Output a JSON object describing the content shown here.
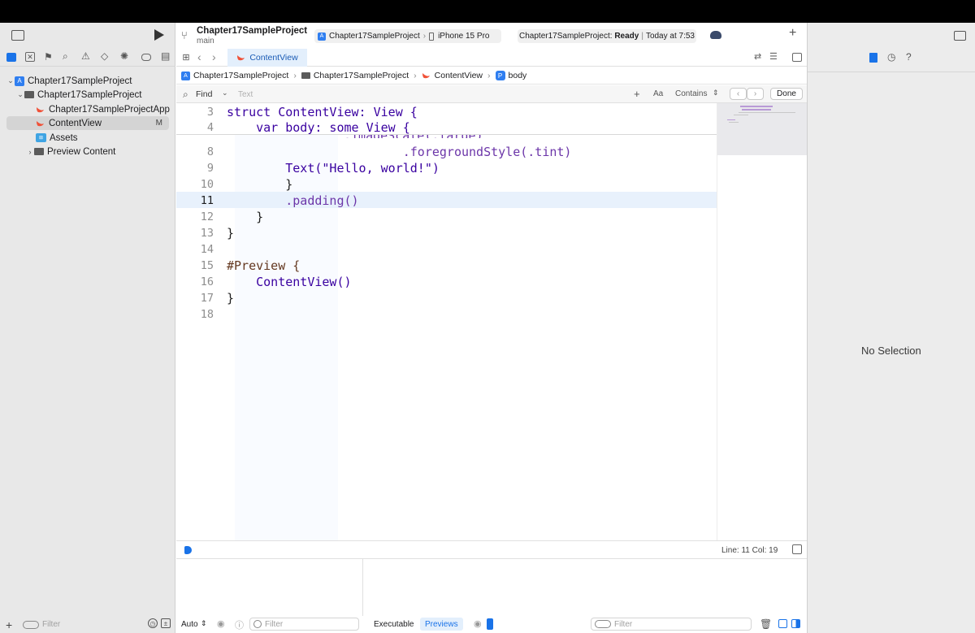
{
  "toolbar": {
    "project_name": "Chapter17SampleProject",
    "branch": "main",
    "scheme_target": "Chapter17SampleProject",
    "device": "iPhone 15 Pro",
    "status_project": "Chapter17SampleProject:",
    "status_state": "Ready",
    "status_time": "Today at 7:53"
  },
  "tab": {
    "label": "ContentView"
  },
  "jumpbar": {
    "items": [
      "Chapter17SampleProject",
      "Chapter17SampleProject",
      "ContentView"
    ],
    "symbol_badge": "P",
    "symbol": "body"
  },
  "find": {
    "mode": "Find",
    "placeholder": "Text",
    "case_label": "Aa",
    "match_mode": "Contains",
    "done_label": "Done"
  },
  "navigator": {
    "items": [
      {
        "label": "Chapter17SampleProject",
        "badge": ""
      },
      {
        "label": "Chapter17SampleProject",
        "badge": ""
      },
      {
        "label": "Chapter17SampleProjectApp",
        "badge": ""
      },
      {
        "label": "ContentView",
        "badge": "M"
      },
      {
        "label": "Assets",
        "badge": ""
      },
      {
        "label": "Preview Content",
        "badge": ""
      }
    ],
    "filter_placeholder": "Filter"
  },
  "code": {
    "sticky_lines": [
      {
        "num": "3",
        "text": "struct ContentView: View {"
      },
      {
        "num": "4",
        "text": "    var body: some View {"
      }
    ],
    "partial_line": ".imageScale(.large)",
    "lines": [
      {
        "num": "8",
        "text": "            .foregroundStyle(.tint)"
      },
      {
        "num": "9",
        "text": "        Text(\"Hello, world!\")"
      },
      {
        "num": "10",
        "text": "        }"
      },
      {
        "num": "11",
        "text": "        .padding()"
      },
      {
        "num": "12",
        "text": "    }"
      },
      {
        "num": "13",
        "text": "}"
      },
      {
        "num": "14",
        "text": ""
      },
      {
        "num": "15",
        "text": "#Preview {"
      },
      {
        "num": "16",
        "text": "    ContentView()"
      },
      {
        "num": "17",
        "text": "}"
      },
      {
        "num": "18",
        "text": ""
      }
    ],
    "active_line": "11"
  },
  "status": {
    "line_col": "Line: 11  Col: 19"
  },
  "debug": {
    "auto_label": "Auto",
    "filter_placeholder": "Filter",
    "executable_label": "Executable",
    "previews_label": "Previews",
    "console_filter_placeholder": "Filter"
  },
  "inspector": {
    "empty_label": "No Selection"
  },
  "colors": {
    "accent": "#1a73e8",
    "swift": "#f05138",
    "keyword": "#9b2393",
    "type": "#3900a0"
  }
}
